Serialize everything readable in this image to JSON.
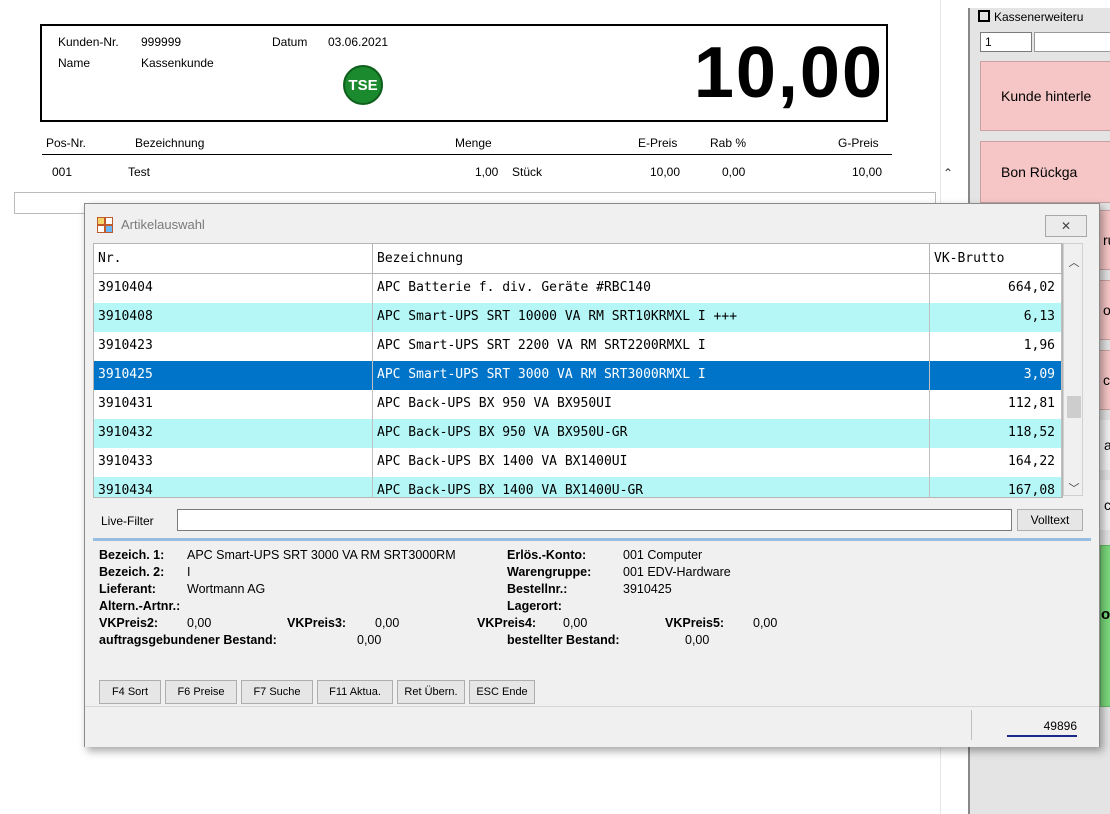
{
  "customer": {
    "nr_label": "Kunden-Nr.",
    "nr_value": "999999",
    "date_label": "Datum",
    "date_value": "03.06.2021",
    "name_label": "Name",
    "name_value": "Kassenkunde",
    "tse_badge": "TSE",
    "total": "10,00"
  },
  "positions": {
    "headers": {
      "pos": "Pos-Nr.",
      "bez": "Bezeichnung",
      "menge": "Menge",
      "epreis": "E-Preis",
      "rab": "Rab %",
      "gpreis": "G-Preis"
    },
    "row": {
      "pos": "001",
      "bez": "Test",
      "menge": "1,00",
      "unit": "Stück",
      "epreis": "10,00",
      "rab": "0,00",
      "gpreis": "10,00"
    }
  },
  "right_panel": {
    "title": "Kassenerweiteru",
    "input_value": "1",
    "buttons": [
      "Kunde hinterle",
      "Bon Rückga",
      "ru",
      "of",
      "ch",
      "a",
      "c",
      "o"
    ]
  },
  "dialog": {
    "title": "Artikelauswahl",
    "close_icon": "close-icon",
    "columns": {
      "nr": "Nr.",
      "bez": "Bezeichnung",
      "vk": "VK-Brutto"
    },
    "rows": [
      {
        "nr": "3910404",
        "bez": "APC Batterie f. div. Geräte #RBC140",
        "vk": "664,02"
      },
      {
        "nr": "3910408",
        "bez": "APC Smart-UPS SRT 10000 VA RM SRT10KRMXL I +++",
        "vk": "6,13"
      },
      {
        "nr": "3910423",
        "bez": "APC Smart-UPS SRT 2200 VA RM SRT2200RMXL I",
        "vk": "1,96"
      },
      {
        "nr": "3910425",
        "bez": "APC Smart-UPS SRT 3000 VA RM SRT3000RMXL I",
        "vk": "3,09"
      },
      {
        "nr": "3910431",
        "bez": "APC Back-UPS BX  950 VA BX950UI",
        "vk": "112,81"
      },
      {
        "nr": "3910432",
        "bez": "APC Back-UPS BX  950 VA BX950U-GR",
        "vk": "118,52"
      },
      {
        "nr": "3910433",
        "bez": "APC Back-UPS BX 1400 VA BX1400UI",
        "vk": "164,22"
      },
      {
        "nr": "3910434",
        "bez": "APC Back-UPS BX 1400 VA BX1400U-GR",
        "vk": "167,08"
      }
    ],
    "live_filter_label": "Live-Filter",
    "live_filter_value": "",
    "volltext_label": "Volltext",
    "details": {
      "bez1_label": "Bezeich. 1:",
      "bez1_value": "APC Smart-UPS SRT 3000 VA RM SRT3000RM",
      "bez2_label": "Bezeich. 2:",
      "bez2_value": "I",
      "lieferant_label": "Lieferant:",
      "lieferant_value": "Wortmann AG",
      "altern_label": "Altern.-Artnr.:",
      "erloes_label": "Erlös.-Konto:",
      "erloes_value": "001 Computer",
      "warengruppe_label": "Warengruppe:",
      "warengruppe_value": "001 EDV-Hardware",
      "bestellnr_label": "Bestellnr.:",
      "bestellnr_value": "3910425",
      "lagerort_label": "Lagerort:",
      "vk2_label": "VKPreis2:",
      "vk2_value": "0,00",
      "vk3_label": "VKPreis3:",
      "vk3_value": "0,00",
      "vk4_label": "VKPreis4:",
      "vk4_value": "0,00",
      "vk5_label": "VKPreis5:",
      "vk5_value": "0,00",
      "auftrag_label": "auftragsgebundener Bestand:",
      "auftrag_value": "0,00",
      "bestellt_label": "bestellter Bestand:",
      "bestellt_value": "0,00"
    },
    "fkeys": [
      "F4 Sort",
      "F6 Preise",
      "F7 Suche",
      "F11 Aktua.",
      "Ret Übern.",
      "ESC Ende"
    ],
    "status_number": "49896"
  },
  "colors": {
    "selected_row": "#0074c8",
    "alt_row": "#b5f7f7",
    "tse": "#1b8a2e",
    "pink_button": "#f6c6c6"
  }
}
